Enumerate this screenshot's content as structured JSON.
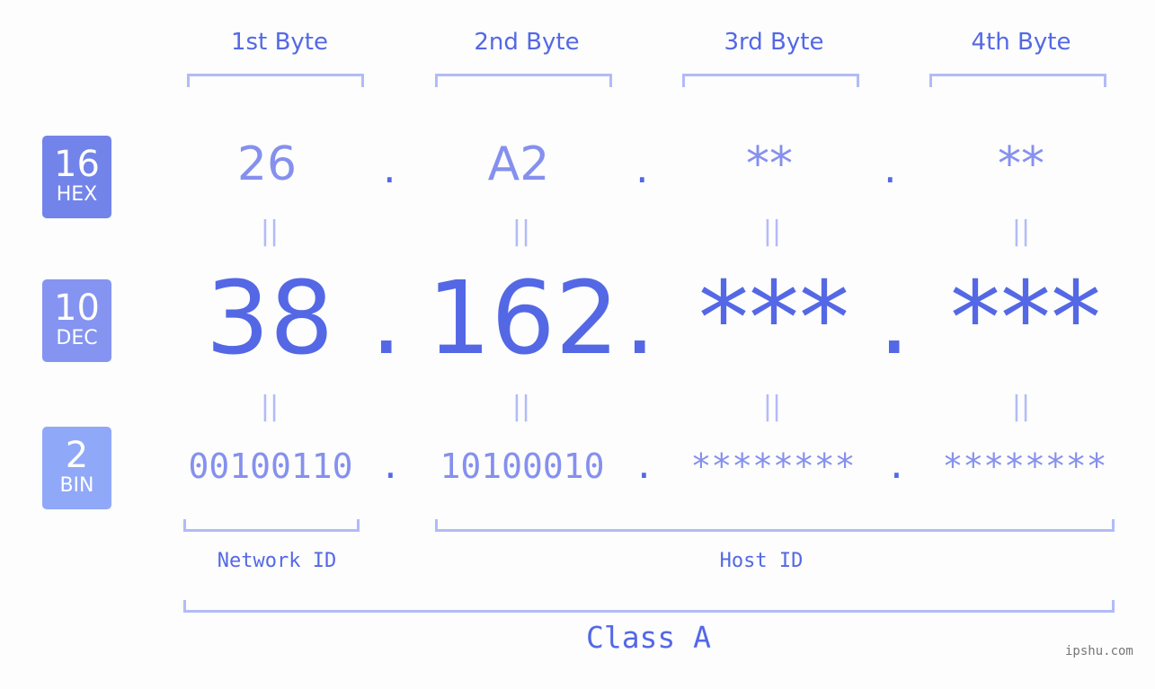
{
  "bytes": [
    {
      "header": "1st Byte",
      "hex": "26",
      "dec": "38",
      "bin": "00100110"
    },
    {
      "header": "2nd Byte",
      "hex": "A2",
      "dec": "162",
      "bin": "10100010"
    },
    {
      "header": "3rd Byte",
      "hex": "**",
      "dec": "***",
      "bin": "********"
    },
    {
      "header": "4th Byte",
      "hex": "**",
      "dec": "***",
      "bin": "********"
    }
  ],
  "bases": [
    {
      "num": "16",
      "label": "HEX",
      "color": "#7284ea"
    },
    {
      "num": "10",
      "label": "DEC",
      "color": "#8494f0"
    },
    {
      "num": "2",
      "label": "BIN",
      "color": "#90a8f8"
    }
  ],
  "separator": ".",
  "equals": "||",
  "network_label": "Network ID",
  "host_label": "Host ID",
  "class_label": "Class A",
  "watermark": "ipshu.com"
}
